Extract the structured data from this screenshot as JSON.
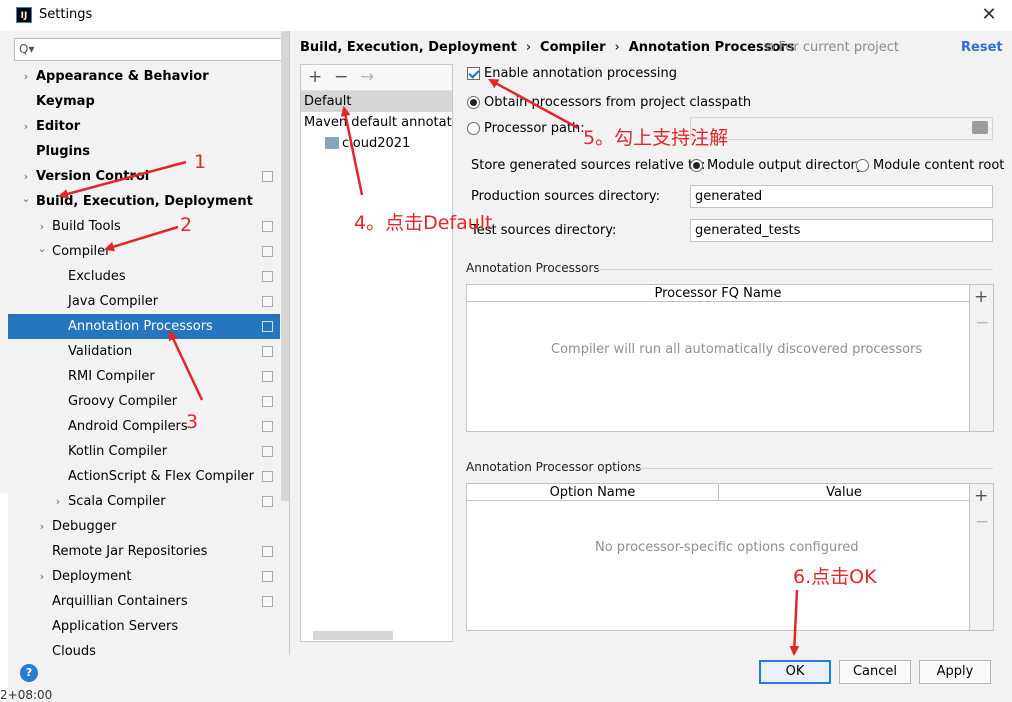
{
  "window": {
    "title": "Settings",
    "app_icon": "IJ"
  },
  "search": {
    "placeholder": "Q▾"
  },
  "tree": [
    {
      "label": "Appearance & Behavior",
      "bold": true,
      "arrow": "right",
      "proj": false
    },
    {
      "label": "Keymap",
      "bold": true,
      "arrow": "",
      "proj": false
    },
    {
      "label": "Editor",
      "bold": true,
      "arrow": "right",
      "proj": false
    },
    {
      "label": "Plugins",
      "bold": true,
      "arrow": "",
      "proj": false
    },
    {
      "label": "Version Control",
      "bold": true,
      "arrow": "right",
      "proj": true
    },
    {
      "label": "Build, Execution, Deployment",
      "bold": true,
      "arrow": "down",
      "proj": false
    },
    {
      "label": "Build Tools",
      "bold": false,
      "arrow": "right",
      "proj": true
    },
    {
      "label": "Compiler",
      "bold": false,
      "arrow": "down",
      "proj": true
    },
    {
      "label": "Excludes",
      "bold": false,
      "arrow": "",
      "proj": true
    },
    {
      "label": "Java Compiler",
      "bold": false,
      "arrow": "",
      "proj": true
    },
    {
      "label": "Annotation Processors",
      "bold": false,
      "arrow": "",
      "proj": true,
      "selected": true
    },
    {
      "label": "Validation",
      "bold": false,
      "arrow": "",
      "proj": true
    },
    {
      "label": "RMI Compiler",
      "bold": false,
      "arrow": "",
      "proj": true
    },
    {
      "label": "Groovy Compiler",
      "bold": false,
      "arrow": "",
      "proj": true
    },
    {
      "label": "Android Compilers",
      "bold": false,
      "arrow": "",
      "proj": true
    },
    {
      "label": "Kotlin Compiler",
      "bold": false,
      "arrow": "",
      "proj": true
    },
    {
      "label": "ActionScript & Flex Compiler",
      "bold": false,
      "arrow": "",
      "proj": true
    },
    {
      "label": "Scala Compiler",
      "bold": false,
      "arrow": "right",
      "proj": true
    },
    {
      "label": "Debugger",
      "bold": false,
      "arrow": "right",
      "proj": false
    },
    {
      "label": "Remote Jar Repositories",
      "bold": false,
      "arrow": "",
      "proj": true
    },
    {
      "label": "Deployment",
      "bold": false,
      "arrow": "right",
      "proj": true
    },
    {
      "label": "Arquillian Containers",
      "bold": false,
      "arrow": "",
      "proj": true
    },
    {
      "label": "Application Servers",
      "bold": false,
      "arrow": "",
      "proj": false
    },
    {
      "label": "Clouds",
      "bold": false,
      "arrow": "",
      "proj": false
    }
  ],
  "breadcrumb": {
    "part1": "Build, Execution, Deployment",
    "part2": "Compiler",
    "part3": "Annotation Processors",
    "sep": "›"
  },
  "for_current_project": "⧉ For current project",
  "reset_label": "Reset",
  "profiles": {
    "add": "+",
    "remove": "−",
    "move": "→",
    "items": [
      "Default",
      "Maven default annotation",
      "cloud2021"
    ]
  },
  "options": {
    "enable_label": "Enable annotation processing",
    "obtain_label": "Obtain processors from project classpath",
    "path_label": "Processor path:",
    "store_label": "Store generated sources relative to:",
    "module_output_label": "Module output directory",
    "module_content_label": "Module content root",
    "prod_dir_label": "Production sources directory:",
    "prod_dir_value": "generated",
    "test_dir_label": "Test sources directory:",
    "test_dir_value": "generated_tests"
  },
  "annotation_processors": {
    "title": "Annotation Processors",
    "column": "Processor FQ Name",
    "empty": "Compiler will run all automatically discovered processors"
  },
  "processor_options": {
    "title": "Annotation Processor options",
    "col1": "Option Name",
    "col2": "Value",
    "empty": "No processor-specific options configured"
  },
  "buttons": {
    "help": "?",
    "ok": "OK",
    "cancel": "Cancel",
    "apply": "Apply"
  },
  "annotations": {
    "a1": "1",
    "a2": "2",
    "a3": "3",
    "a4": "4。点击Default",
    "a5": "5。勾上支持注解",
    "a6": "6.点击OK"
  },
  "bg_text": "2+08:00"
}
